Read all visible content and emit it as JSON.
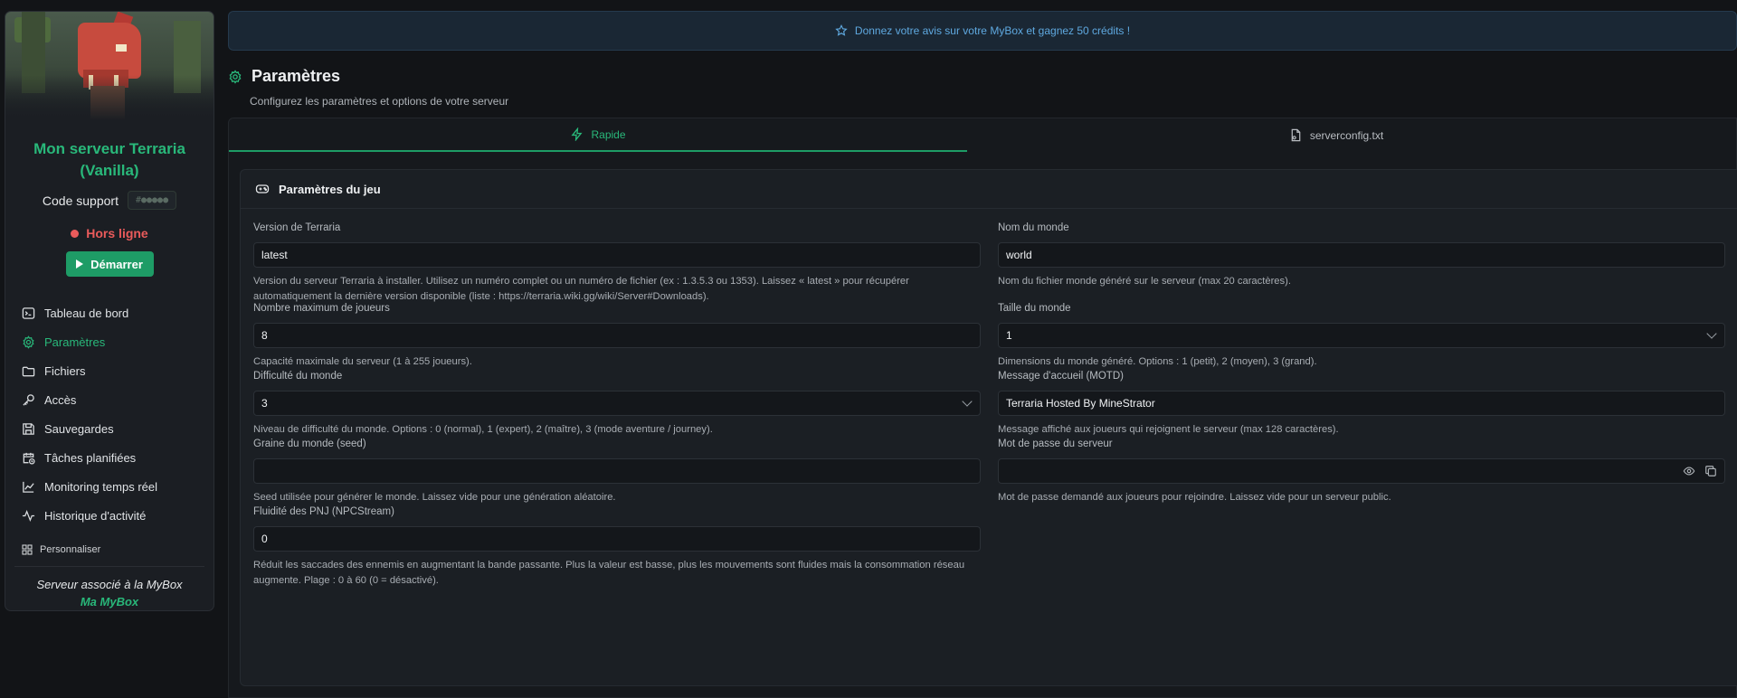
{
  "sidebar": {
    "server_name": "Mon serveur Terraria (Vanilla)",
    "support_label": "Code support",
    "support_code": "#●●●●●",
    "status": "Hors ligne",
    "start_label": "Démarrer",
    "nav": [
      {
        "label": "Tableau de bord",
        "icon": "terminal-icon"
      },
      {
        "label": "Paramètres",
        "icon": "gear-icon",
        "active": true
      },
      {
        "label": "Fichiers",
        "icon": "folder-icon"
      },
      {
        "label": "Accès",
        "icon": "key-icon"
      },
      {
        "label": "Sauvegardes",
        "icon": "save-icon"
      },
      {
        "label": "Tâches planifiées",
        "icon": "calendar-clock-icon"
      },
      {
        "label": "Monitoring temps réel",
        "icon": "chart-line-icon"
      },
      {
        "label": "Historique d'activité",
        "icon": "activity-icon"
      }
    ],
    "personalize": "Personnaliser",
    "assoc_text": "Serveur associé à la MyBox",
    "assoc_link": "Ma MyBox"
  },
  "notice": {
    "text": "Donnez votre avis sur votre MyBox et gagnez 50 crédits !"
  },
  "page": {
    "title": "Paramètres",
    "subtitle": "Configurez les paramètres et options de votre serveur"
  },
  "tabs": [
    {
      "label": "Rapide",
      "active": true
    },
    {
      "label": "serverconfig.txt"
    }
  ],
  "section": {
    "title": "Paramètres du jeu"
  },
  "fields": {
    "version": {
      "label": "Version de Terraria",
      "value": "latest",
      "help": "Version du serveur Terraria à installer. Utilisez un numéro complet ou un numéro de fichier (ex : 1.3.5.3 ou 1353). Laissez « latest » pour récupérer automatiquement la dernière version disponible (liste : https://terraria.wiki.gg/wiki/Server#Downloads)."
    },
    "world_name": {
      "label": "Nom du monde",
      "value": "world",
      "help": "Nom du fichier monde généré sur le serveur (max 20 caractères)."
    },
    "max_players": {
      "label": "Nombre maximum de joueurs",
      "value": "8",
      "help": "Capacité maximale du serveur (1 à 255 joueurs)."
    },
    "world_size": {
      "label": "Taille du monde",
      "value": "1",
      "help": "Dimensions du monde généré. Options : 1 (petit), 2 (moyen), 3 (grand)."
    },
    "difficulty": {
      "label": "Difficulté du monde",
      "value": "3",
      "help": "Niveau de difficulté du monde. Options : 0 (normal), 1 (expert), 2 (maître), 3 (mode aventure / journey)."
    },
    "motd": {
      "label": "Message d'accueil (MOTD)",
      "value": "Terraria Hosted By MineStrator",
      "help": "Message affiché aux joueurs qui rejoignent le serveur (max 128 caractères)."
    },
    "seed": {
      "label": "Graine du monde (seed)",
      "value": "",
      "help": "Seed utilisée pour générer le monde. Laissez vide pour une génération aléatoire."
    },
    "password": {
      "label": "Mot de passe du serveur",
      "value": "",
      "help": "Mot de passe demandé aux joueurs pour rejoindre. Laissez vide pour un serveur public."
    },
    "npc_stream": {
      "label": "Fluidité des PNJ (NPCStream)",
      "value": "0",
      "help": "Réduit les saccades des ennemis en augmentant la bande passante. Plus la valeur est basse, plus les mouvements sont fluides mais la consommation réseau augmente. Plage : 0 à 60 (0 = désactivé)."
    }
  },
  "colors": {
    "accent": "#1e9c66",
    "accent_text": "#29b87a",
    "danger": "#ea5b5b",
    "info": "#5fa9e0"
  }
}
